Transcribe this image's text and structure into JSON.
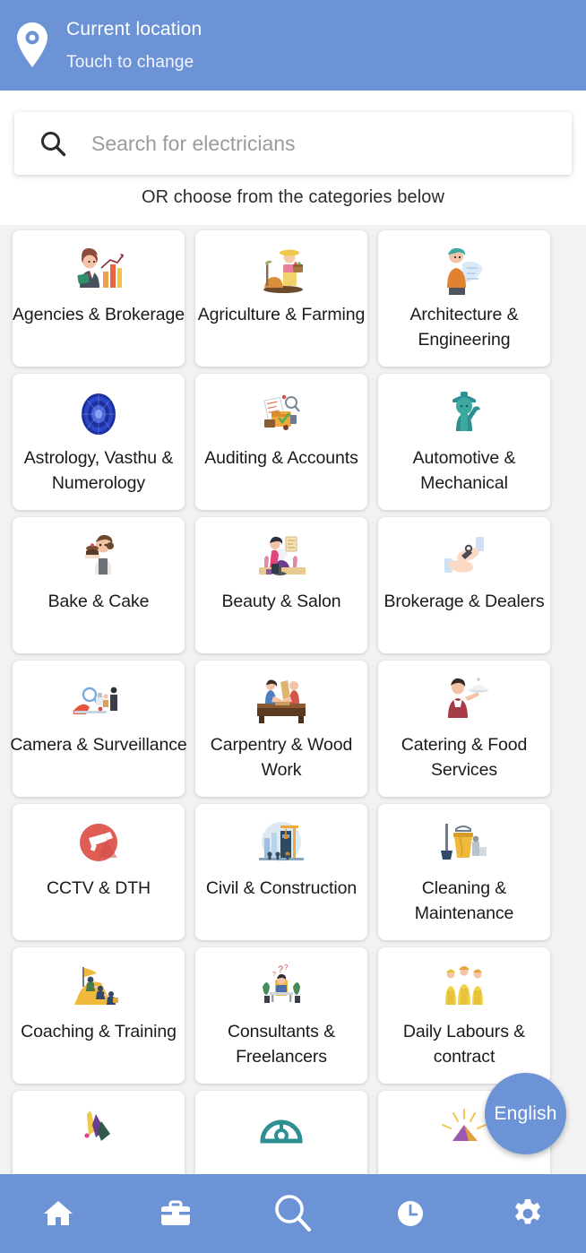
{
  "theme": {
    "brand_blue": "#6b93d6",
    "page_background": "#f2f2f2",
    "card_background": "#ffffff",
    "text_primary": "#1a1a1a",
    "placeholder_gray": "#9b9b9b"
  },
  "header": {
    "icon": "location-pin-icon",
    "title": "Current location",
    "subtitle": "Touch to change"
  },
  "search": {
    "icon": "search-icon",
    "placeholder": "Search for electricians",
    "value": "",
    "hint": "OR choose from the categories below"
  },
  "categories": [
    {
      "label": "Agencies & Brokerage",
      "icon": "businessman-chart-icon",
      "wrap": true
    },
    {
      "label": "Agriculture & Farming",
      "icon": "farmer-basket-icon",
      "wrap": true
    },
    {
      "label": "Architecture & Engineering",
      "icon": "architect-blueprint-icon",
      "wrap": true
    },
    {
      "label": "Astrology, Vasthu & Numerology",
      "icon": "zodiac-wheel-icon",
      "wrap": true
    },
    {
      "label": "Auditing & Accounts",
      "icon": "documents-audit-icon",
      "wrap": false
    },
    {
      "label": "Automotive & Mechanical",
      "icon": "mechanic-wrench-icon",
      "wrap": true
    },
    {
      "label": "Bake & Cake",
      "icon": "baker-cake-icon",
      "wrap": false
    },
    {
      "label": "Beauty & Salon",
      "icon": "salon-chair-icon",
      "wrap": false
    },
    {
      "label": "Brokerage & Dealers",
      "icon": "handshake-keys-icon",
      "wrap": false
    },
    {
      "label": "Camera & Surveillance",
      "icon": "camera-studio-icon",
      "wrap": true
    },
    {
      "label": "Carpentry & Wood Work",
      "icon": "carpenter-bench-icon",
      "wrap": true
    },
    {
      "label": "Catering & Food Services",
      "icon": "waiter-tray-icon",
      "wrap": true
    },
    {
      "label": "CCTV & DTH",
      "icon": "cctv-camera-icon",
      "wrap": false
    },
    {
      "label": "Civil & Construction",
      "icon": "construction-crane-icon",
      "wrap": false
    },
    {
      "label": "Cleaning & Maintenance",
      "icon": "cleaning-bucket-icon",
      "wrap": true
    },
    {
      "label": "Coaching & Training",
      "icon": "team-climb-flag-icon",
      "wrap": false
    },
    {
      "label": "Consultants & Freelancers",
      "icon": "consultant-desk-icon",
      "wrap": true
    },
    {
      "label": "Daily Labours & contract",
      "icon": "workers-group-icon",
      "wrap": true
    },
    {
      "label": "",
      "icon": "design-pens-icon",
      "wrap": false
    },
    {
      "label": "",
      "icon": "driving-wheel-icon",
      "wrap": false
    },
    {
      "label": "",
      "icon": "electric-spark-icon",
      "wrap": false
    }
  ],
  "language_fab": {
    "label": "English"
  },
  "bottom_nav": [
    {
      "name": "home-icon",
      "label": "Home"
    },
    {
      "name": "briefcase-icon",
      "label": "Jobs"
    },
    {
      "name": "search-icon",
      "label": "Search"
    },
    {
      "name": "clock-icon",
      "label": "History"
    },
    {
      "name": "gear-icon",
      "label": "Settings"
    }
  ]
}
